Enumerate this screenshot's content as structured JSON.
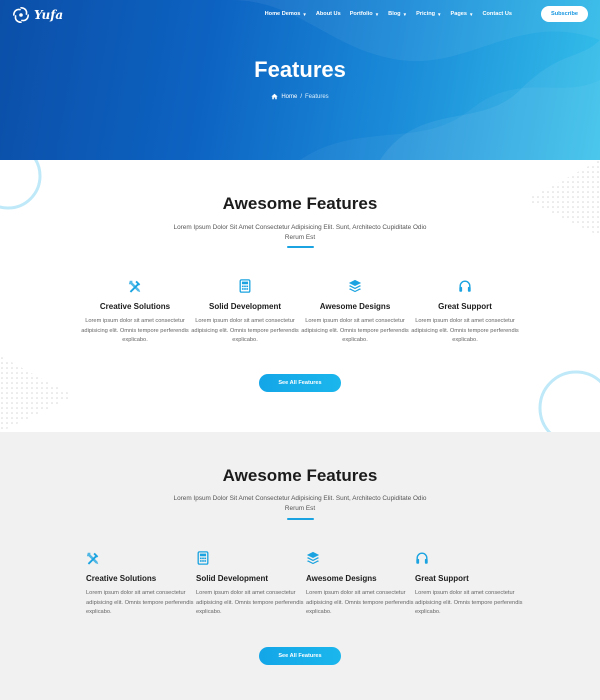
{
  "header": {
    "logo_text": "Yufa",
    "nav": [
      {
        "label": "Home Demos",
        "dropdown": true
      },
      {
        "label": "About Us",
        "dropdown": false
      },
      {
        "label": "Portfolio",
        "dropdown": true
      },
      {
        "label": "Blog",
        "dropdown": true
      },
      {
        "label": "Pricing",
        "dropdown": true
      },
      {
        "label": "Pages",
        "dropdown": true
      },
      {
        "label": "Contact Us",
        "dropdown": false
      }
    ],
    "subscribe_label": "Subscribe"
  },
  "hero": {
    "title": "Features",
    "breadcrumb": {
      "home": "Home",
      "separator": "/",
      "current": "Features"
    }
  },
  "section1": {
    "title": "Awesome Features",
    "subtitle": "Lorem Ipsum Dolor Sit Amet Consectetur Adipisicing Elit. Sunt, Architecto Cupiditate Odio Rerum Est",
    "features": [
      {
        "icon": "tools-icon",
        "title": "Creative Solutions",
        "desc": "Lorem ipsum dolor sit amet consectetur adipisicing elit. Omnis tempore perferendis explicabo."
      },
      {
        "icon": "calculator-icon",
        "title": "Solid Development",
        "desc": "Lorem ipsum dolor sit amet consectetur adipisicing elit. Omnis tempore perferendis explicabo."
      },
      {
        "icon": "layers-icon",
        "title": "Awesome Designs",
        "desc": "Lorem ipsum dolor sit amet consectetur adipisicing elit. Omnis tempore perferendis explicabo."
      },
      {
        "icon": "headphones-icon",
        "title": "Great Support",
        "desc": "Lorem ipsum dolor sit amet consectetur adipisicing elit. Omnis tempore perferendis explicabo."
      }
    ],
    "button_label": "See All Features"
  },
  "section2": {
    "title": "Awesome Features",
    "subtitle": "Lorem Ipsum Dolor Sit Amet Consectetur Adipisicing Elit. Sunt, Architecto Cupiditate Odio Rerum Est",
    "features": [
      {
        "icon": "tools-icon",
        "title": "Creative Solutions",
        "desc": "Lorem ipsum dolor sit amet consectetur adipisicing elit. Omnis tempore perferendis explicabo."
      },
      {
        "icon": "calculator-icon",
        "title": "Solid Development",
        "desc": "Lorem ipsum dolor sit amet consectetur adipisicing elit. Omnis tempore perferendis explicabo."
      },
      {
        "icon": "layers-icon",
        "title": "Awesome Designs",
        "desc": "Lorem ipsum dolor sit amet consectetur adipisicing elit. Omnis tempore perferendis explicabo."
      },
      {
        "icon": "headphones-icon",
        "title": "Great Support",
        "desc": "Lorem ipsum dolor sit amet consectetur adipisicing elit. Omnis tempore perferendis explicabo."
      }
    ],
    "button_label": "See All Features"
  },
  "colors": {
    "accent": "#1aa3e0",
    "hero_dark": "#0b4fa8",
    "hero_light": "#34c0ea",
    "section_alt_bg": "#f1f1f1"
  }
}
